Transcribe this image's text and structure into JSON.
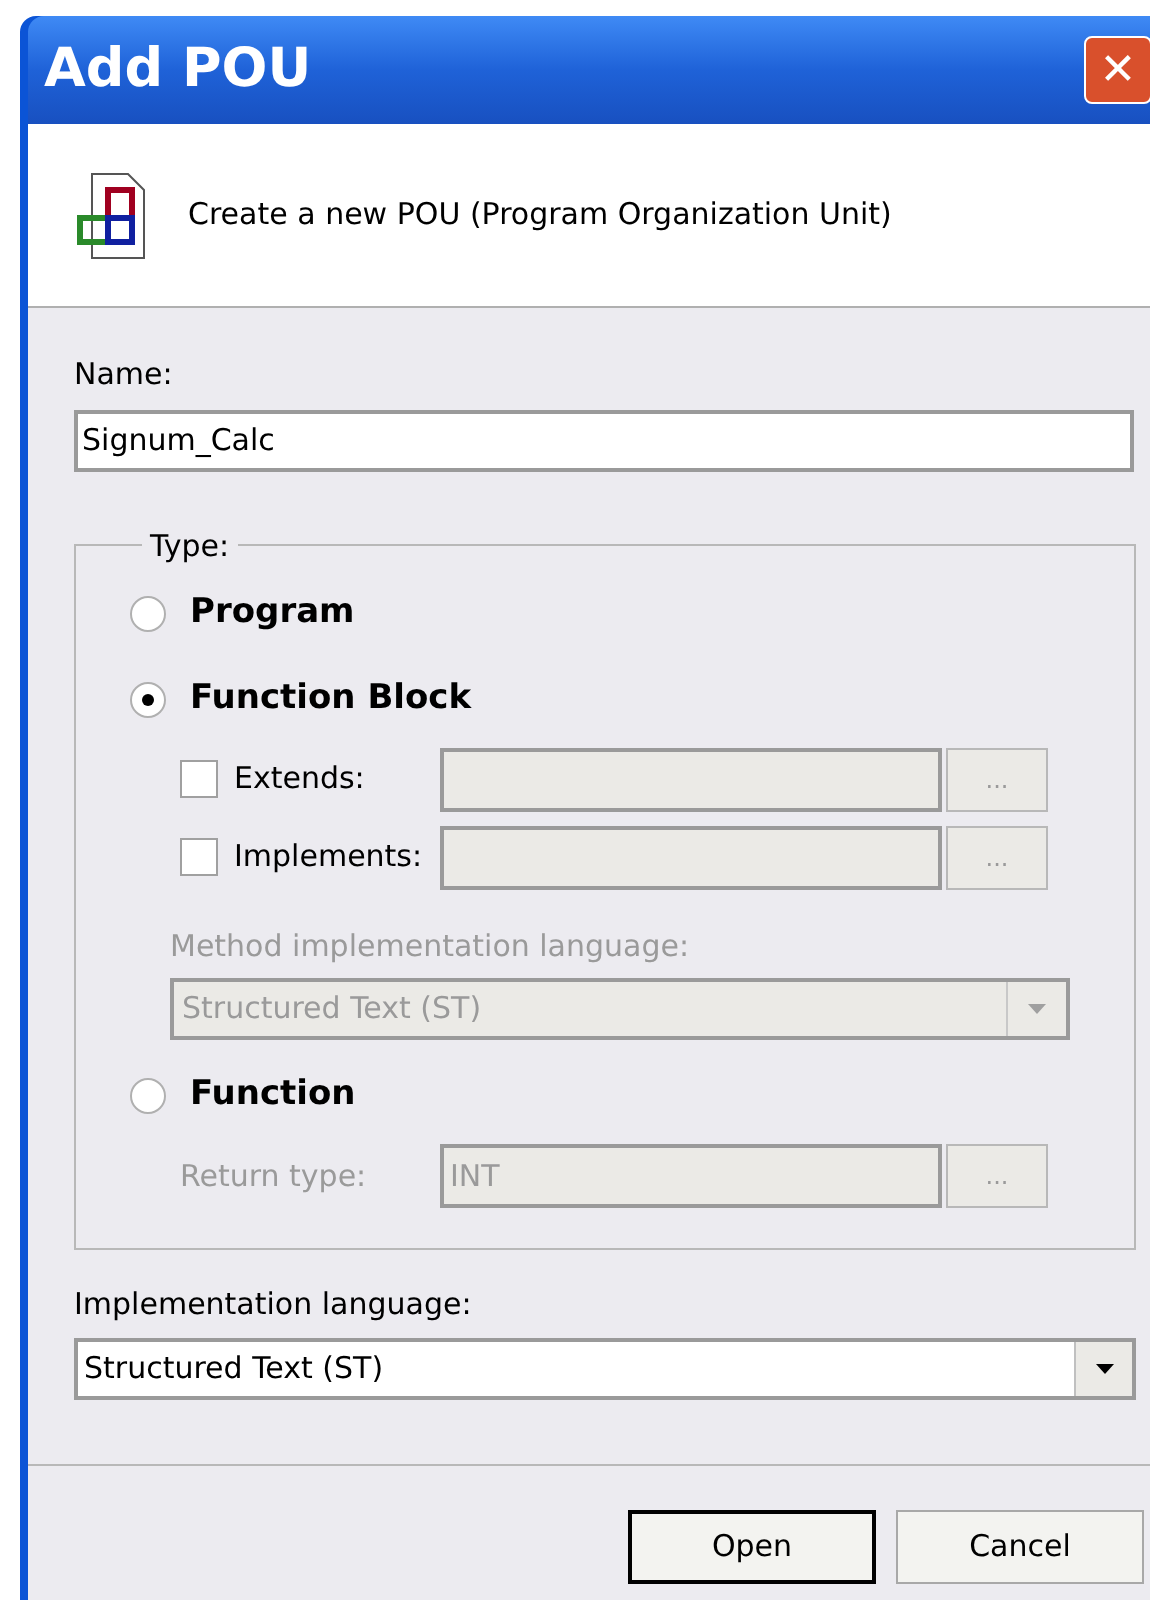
{
  "window": {
    "title": "Add POU",
    "close": "✕"
  },
  "header": {
    "text": "Create a new POU (Program Organization Unit)"
  },
  "name": {
    "label": "Name:",
    "value": "Signum_Calc"
  },
  "type_group": {
    "label": "Type:",
    "options": [
      {
        "label": "Program",
        "selected": false
      },
      {
        "label": "Function Block",
        "selected": true,
        "rows": [
          {
            "kind": "checkbox",
            "label": "Extends:",
            "checked": false,
            "browse": "...",
            "disabled": true
          },
          {
            "kind": "checkbox",
            "label": "Implements:",
            "checked": false,
            "browse": "...",
            "disabled": true
          },
          {
            "kind": "combo",
            "label": "Method implementation language:",
            "value": "Structured Text (ST)",
            "disabled": true
          }
        ]
      },
      {
        "label": "Function",
        "selected": false,
        "rows": [
          {
            "kind": "field",
            "label": "Return type:",
            "value": "INT",
            "browse": "...",
            "disabled": true
          }
        ]
      }
    ]
  },
  "implementation_language": {
    "label": "Implementation language:",
    "value": "Structured Text (ST)"
  },
  "buttons": [
    {
      "label": "Open",
      "default": true
    },
    {
      "label": "Cancel",
      "default": false
    }
  ]
}
